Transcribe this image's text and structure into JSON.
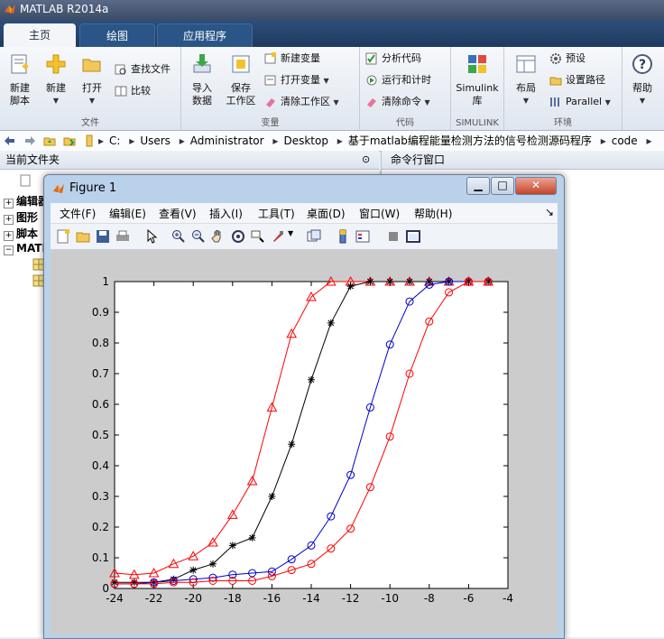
{
  "app": {
    "title": "MATLAB R2014a"
  },
  "tabs": [
    {
      "label": "主页"
    },
    {
      "label": "绘图"
    },
    {
      "label": "应用程序"
    }
  ],
  "ribbon": {
    "file_group": {
      "label": "文件",
      "new_script": "新建\n脚本",
      "new": "新建",
      "open": "打开",
      "find_files": "查找文件",
      "compare": "比较"
    },
    "variable_group": {
      "label": "变量",
      "import_data": "导入\n数据",
      "save_workspace": "保存\n工作区",
      "new_variable": "新建变量",
      "open_variable": "打开变量",
      "clear_workspace": "清除工作区"
    },
    "code_group": {
      "label": "代码",
      "analyze_code": "分析代码",
      "run_and_time": "运行和计时",
      "clear_commands": "清除命令"
    },
    "simulink_group": {
      "label": "SIMULINK",
      "simulink_library": "Simulink\n库"
    },
    "environment_group": {
      "label": "环境",
      "layout": "布局",
      "preferences": "预设",
      "set_path": "设置路径",
      "parallel": "Parallel"
    },
    "help": "帮助"
  },
  "address": {
    "crumbs": [
      "C:",
      "Users",
      "Administrator",
      "Desktop",
      "基于matlab编程能量检测方法的信号检测源码程序",
      "code"
    ]
  },
  "left_panel": {
    "title": "当前文件夹",
    "items": [
      {
        "label": "编辑器"
      },
      {
        "label": "图形"
      },
      {
        "label": "脚本"
      },
      {
        "label": "MATLAB"
      }
    ]
  },
  "right_panel": {
    "title": "命令行窗口"
  },
  "figure": {
    "title": "Figure 1",
    "menu": [
      "文件(F)",
      "编辑(E)",
      "查看(V)",
      "插入(I)",
      "工具(T)",
      "桌面(D)",
      "窗口(W)",
      "帮助(H)"
    ],
    "menu_arrow": "↘"
  },
  "chart_data": {
    "type": "line",
    "xlim": [
      -24,
      -4
    ],
    "ylim": [
      0,
      1
    ],
    "xticks": [
      -24,
      -22,
      -20,
      -18,
      -16,
      -14,
      -12,
      -10,
      -8,
      -6,
      -4
    ],
    "yticks": [
      0,
      0.1,
      0.2,
      0.3,
      0.4,
      0.5,
      0.6,
      0.7,
      0.8,
      0.9,
      1
    ],
    "grid": false,
    "series": [
      {
        "color": "#ff0000",
        "marker": "triangle",
        "x": [
          -24,
          -23,
          -22,
          -21,
          -20,
          -19,
          -18,
          -17,
          -16,
          -15,
          -14,
          -13,
          -12,
          -11,
          -10,
          -9,
          -8,
          -7,
          -6,
          -5
        ],
        "y": [
          0.05,
          0.045,
          0.05,
          0.08,
          0.105,
          0.15,
          0.24,
          0.35,
          0.59,
          0.83,
          0.95,
          1.0,
          1.0,
          1.0,
          1.0,
          1.0,
          1.0,
          1.0,
          1.0,
          1.0
        ]
      },
      {
        "color": "#000000",
        "marker": "star",
        "x": [
          -24,
          -23,
          -22,
          -21,
          -20,
          -19,
          -18,
          -17,
          -16,
          -15,
          -14,
          -13,
          -12,
          -11,
          -10,
          -9,
          -8,
          -7,
          -6,
          -5
        ],
        "y": [
          0.02,
          0.02,
          0.02,
          0.03,
          0.06,
          0.08,
          0.14,
          0.165,
          0.3,
          0.47,
          0.68,
          0.865,
          0.985,
          1.0,
          1.0,
          1.0,
          1.0,
          1.0,
          1.0,
          1.0
        ]
      },
      {
        "color": "#0000cc",
        "marker": "circle",
        "x": [
          -24,
          -23,
          -22,
          -21,
          -20,
          -19,
          -18,
          -17,
          -16,
          -15,
          -14,
          -13,
          -12,
          -11,
          -10,
          -9,
          -8,
          -7,
          -6,
          -5
        ],
        "y": [
          0.015,
          0.015,
          0.02,
          0.025,
          0.03,
          0.035,
          0.045,
          0.05,
          0.055,
          0.095,
          0.14,
          0.235,
          0.37,
          0.59,
          0.795,
          0.935,
          0.99,
          1.0,
          1.0,
          1.0
        ]
      },
      {
        "color": "#ff0000",
        "marker": "circle",
        "x": [
          -24,
          -23,
          -22,
          -21,
          -20,
          -19,
          -18,
          -17,
          -16,
          -15,
          -14,
          -13,
          -12,
          -11,
          -10,
          -9,
          -8,
          -7,
          -6,
          -5
        ],
        "y": [
          0.015,
          0.015,
          0.015,
          0.02,
          0.02,
          0.025,
          0.025,
          0.025,
          0.04,
          0.06,
          0.08,
          0.13,
          0.195,
          0.33,
          0.495,
          0.7,
          0.87,
          0.965,
          1.0,
          1.0
        ]
      }
    ]
  }
}
